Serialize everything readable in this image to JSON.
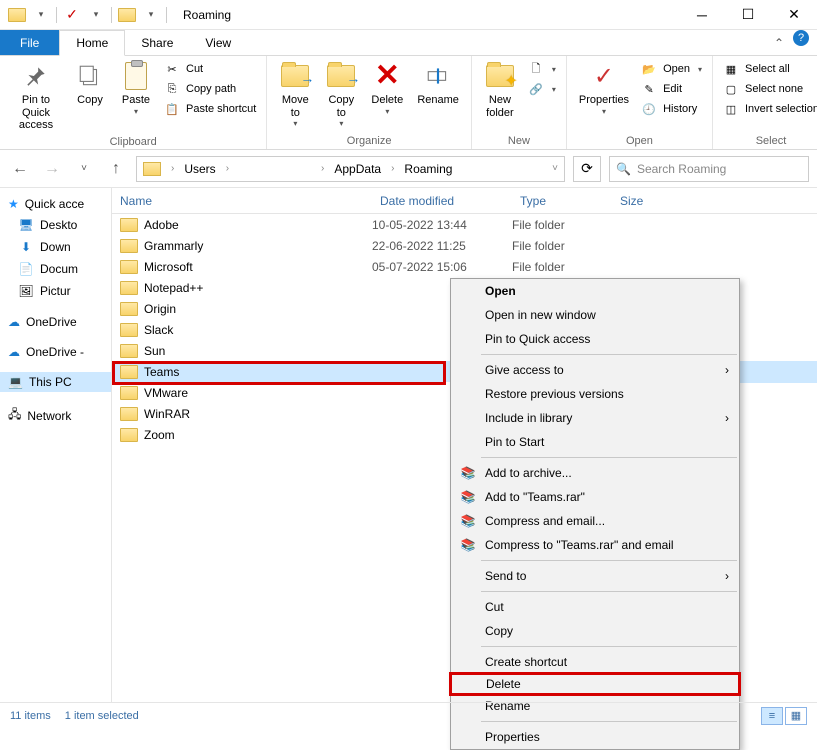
{
  "title": "Roaming",
  "tabs": {
    "file": "File",
    "home": "Home",
    "share": "Share",
    "view": "View"
  },
  "ribbon": {
    "clipboard": {
      "label": "Clipboard",
      "pin": "Pin to Quick\naccess",
      "copy": "Copy",
      "paste": "Paste",
      "cut": "Cut",
      "copy_path": "Copy path",
      "paste_shortcut": "Paste shortcut"
    },
    "organize": {
      "label": "Organize",
      "move_to": "Move\nto",
      "copy_to": "Copy\nto",
      "delete": "Delete",
      "rename": "Rename"
    },
    "new_": {
      "label": "New",
      "new_folder": "New\nfolder"
    },
    "open": {
      "label": "Open",
      "properties": "Properties",
      "open": "Open",
      "edit": "Edit",
      "history": "History"
    },
    "select": {
      "label": "Select",
      "select_all": "Select all",
      "select_none": "Select none",
      "invert": "Invert selection"
    }
  },
  "breadcrumb": {
    "users": "Users",
    "appdata": "AppData",
    "roaming": "Roaming"
  },
  "search": {
    "placeholder": "Search Roaming"
  },
  "sidebar": {
    "quick": "Quick acce",
    "desktop": "Deskto",
    "downloads": "Down",
    "documents": "Docum",
    "pictures": "Pictur",
    "onedrive1": "OneDrive",
    "onedrive2": "OneDrive -",
    "thispc": "This PC",
    "network": "Network"
  },
  "columns": {
    "name": "Name",
    "date": "Date modified",
    "type": "Type",
    "size": "Size"
  },
  "files": [
    {
      "name": "Adobe",
      "date": "10-05-2022 13:44",
      "type": "File folder"
    },
    {
      "name": "Grammarly",
      "date": "22-06-2022 11:25",
      "type": "File folder"
    },
    {
      "name": "Microsoft",
      "date": "05-07-2022 15:06",
      "type": "File folder"
    },
    {
      "name": "Notepad++",
      "date": "",
      "type": ""
    },
    {
      "name": "Origin",
      "date": "",
      "type": ""
    },
    {
      "name": "Slack",
      "date": "",
      "type": ""
    },
    {
      "name": "Sun",
      "date": "",
      "type": ""
    },
    {
      "name": "Teams",
      "date": "",
      "type": "",
      "selected": true
    },
    {
      "name": "VMware",
      "date": "",
      "type": ""
    },
    {
      "name": "WinRAR",
      "date": "",
      "type": ""
    },
    {
      "name": "Zoom",
      "date": "",
      "type": ""
    }
  ],
  "context_menu": {
    "open": "Open",
    "open_new_window": "Open in new window",
    "pin_quick": "Pin to Quick access",
    "give_access": "Give access to",
    "restore_prev": "Restore previous versions",
    "include_library": "Include in library",
    "pin_start": "Pin to Start",
    "add_archive": "Add to archive...",
    "add_teams_rar": "Add to \"Teams.rar\"",
    "compress_email": "Compress and email...",
    "compress_teams_email": "Compress to \"Teams.rar\" and email",
    "send_to": "Send to",
    "cut": "Cut",
    "copy": "Copy",
    "create_shortcut": "Create shortcut",
    "delete": "Delete",
    "rename": "Rename",
    "properties": "Properties"
  },
  "status": {
    "items": "11 items",
    "selected": "1 item selected"
  }
}
